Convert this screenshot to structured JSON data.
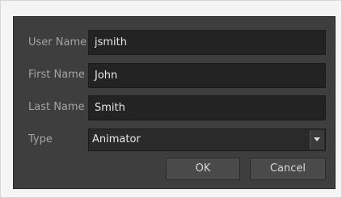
{
  "dialog": {
    "fields": [
      {
        "label": "User Name",
        "value": "jsmith"
      },
      {
        "label": "First Name",
        "value": "John"
      },
      {
        "label": "Last Name",
        "value": "Smith"
      }
    ],
    "type": {
      "label": "Type",
      "selected": "Animator"
    },
    "buttons": {
      "ok": "OK",
      "cancel": "Cancel"
    }
  }
}
